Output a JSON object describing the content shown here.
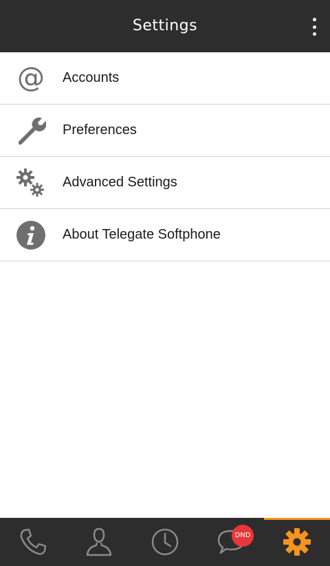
{
  "header": {
    "title": "Settings"
  },
  "settings_items": [
    {
      "label": "Accounts",
      "icon": "at-sign-icon"
    },
    {
      "label": "Preferences",
      "icon": "wrench-icon"
    },
    {
      "label": "Advanced Settings",
      "icon": "gears-icon"
    },
    {
      "label": "About Telegate Softphone",
      "icon": "info-icon"
    }
  ],
  "bottom_nav": {
    "tabs": [
      {
        "name": "phone-icon"
      },
      {
        "name": "contact-icon"
      },
      {
        "name": "clock-icon"
      },
      {
        "name": "chat-icon",
        "badge": "DND"
      },
      {
        "name": "settings-gear-icon",
        "active": true
      }
    ]
  },
  "colors": {
    "bar": "#2d2d2d",
    "accent": "#f7931e",
    "icon_gray": "#6f6f6f",
    "badge": "#e8373a"
  }
}
